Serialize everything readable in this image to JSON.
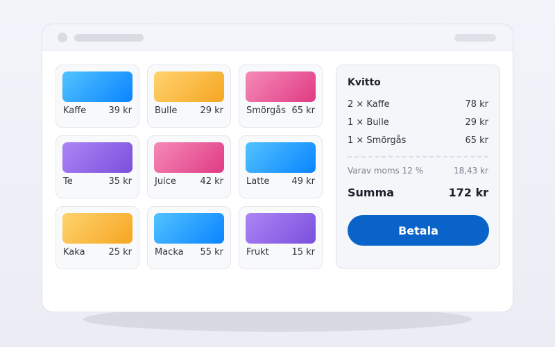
{
  "products": [
    {
      "name": "Kaffe",
      "price": "39 kr",
      "color_from": "#52c3ff",
      "color_to": "#0a84ff"
    },
    {
      "name": "Bulle",
      "price": "29 kr",
      "color_from": "#ffd36e",
      "color_to": "#f5a623"
    },
    {
      "name": "Smörgås",
      "price": "65 kr",
      "color_from": "#f58ab7",
      "color_to": "#e03a84"
    },
    {
      "name": "Te",
      "price": "35 kr",
      "color_from": "#ad85f5",
      "color_to": "#7b4fdc"
    },
    {
      "name": "Juice",
      "price": "42 kr",
      "color_from": "#f58ab7",
      "color_to": "#e03a84"
    },
    {
      "name": "Latte",
      "price": "49 kr",
      "color_from": "#52c3ff",
      "color_to": "#0a84ff"
    },
    {
      "name": "Kaka",
      "price": "25 kr",
      "color_from": "#ffd36e",
      "color_to": "#f5a623"
    },
    {
      "name": "Macka",
      "price": "55 kr",
      "color_from": "#52c3ff",
      "color_to": "#0a84ff"
    },
    {
      "name": "Frukt",
      "price": "15 kr",
      "color_from": "#ad85f5",
      "color_to": "#7b4fdc"
    }
  ],
  "receipt": {
    "title": "Kvitto",
    "lines": [
      {
        "item": "2 × Kaffe",
        "amount": "78 kr"
      },
      {
        "item": "1 × Bulle",
        "amount": "29 kr"
      },
      {
        "item": "1 × Smörgås",
        "amount": "65 kr"
      }
    ],
    "vat_label": "Varav moms 12 %",
    "vat_amount": "18,43 kr",
    "total_label": "Summa",
    "total_amount": "172 kr",
    "pay_label": "Betala",
    "pay_color": "#0a63c9"
  }
}
